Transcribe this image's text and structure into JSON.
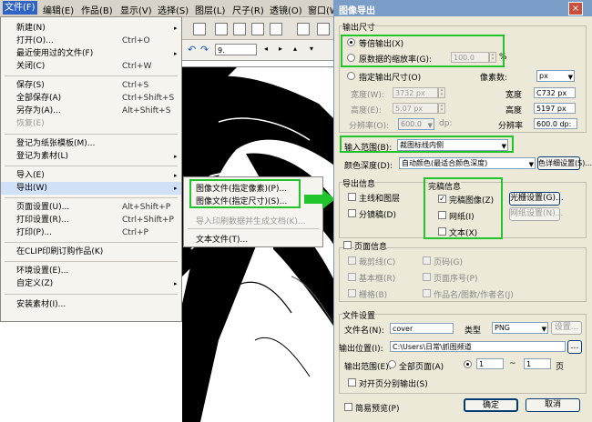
{
  "menubar": {
    "items": [
      "文件(F)",
      "编辑(E)",
      "作品(B)",
      "显示(V)",
      "选择(S)",
      "图层(L)",
      "尺子(R)",
      "透镜(O)",
      "窗口(W)"
    ]
  },
  "toolbar": {
    "zoom_value": "9."
  },
  "file_menu": {
    "items": [
      {
        "label": "新建(N)",
        "shortcut": "",
        "arrow": "▸"
      },
      {
        "label": "打开(O)...",
        "shortcut": "Ctrl+O",
        "arrow": ""
      },
      {
        "label": "最近使用过的文件(F)",
        "shortcut": "",
        "arrow": "▸"
      },
      {
        "label": "关闭(C)",
        "shortcut": "Ctrl+W",
        "arrow": ""
      },
      {
        "label": "保存(S)",
        "shortcut": "Ctrl+S",
        "arrow": ""
      },
      {
        "label": "全部保存(A)",
        "shortcut": "Ctrl+Shift+S",
        "arrow": ""
      },
      {
        "label": "另存为(A)...",
        "shortcut": "Alt+Shift+S",
        "arrow": ""
      },
      {
        "label": "恢复(E)",
        "shortcut": "",
        "arrow": ""
      },
      {
        "label": "登记为纸张模板(M)...",
        "shortcut": "",
        "arrow": ""
      },
      {
        "label": "登记为素材(L)",
        "shortcut": "",
        "arrow": "▸"
      },
      {
        "label": "导入(E)",
        "shortcut": "",
        "arrow": "▸"
      },
      {
        "label": "导出(W)",
        "shortcut": "",
        "arrow": "▸"
      },
      {
        "label": "页面设置(U)...",
        "shortcut": "Alt+Shift+P",
        "arrow": ""
      },
      {
        "label": "打印设置(R)...",
        "shortcut": "Ctrl+Shift+P",
        "arrow": ""
      },
      {
        "label": "打印(P)...",
        "shortcut": "Ctrl+P",
        "arrow": ""
      },
      {
        "label": "在CLIP印刷订购作品(K)",
        "shortcut": "",
        "arrow": ""
      },
      {
        "label": "环境设置(E)...",
        "shortcut": "",
        "arrow": ""
      },
      {
        "label": "自定义(Z)",
        "shortcut": "",
        "arrow": "▸"
      },
      {
        "label": "安装素材(I)...",
        "shortcut": "",
        "arrow": ""
      }
    ]
  },
  "export_submenu": {
    "items": [
      "图像文件(指定像素)(P)...",
      "图像文件(指定尺寸)(S)...",
      "导入印刷数据并生成文档(K)...",
      "文本文件(T)..."
    ]
  },
  "dialog": {
    "title": "图像导出",
    "output_size": {
      "group_label": "输出尺寸",
      "equal": "等倍输出(X)",
      "scale_label": "原数据的缩放率(G):",
      "scale_value": "100.0",
      "scale_unit": "%",
      "specify": "指定输出尺寸(O)",
      "pixel_count": "像素数:",
      "unit_px": "px",
      "width_label": "宽度(W):",
      "width_value": "3732 px",
      "height_label": "高度(E):",
      "height_value": "5.07 px",
      "res_label": "分辨率(O):",
      "res_value": "600.0",
      "res_unit": "dp:",
      "right_w_label": "宽度",
      "right_w_value": "C732 px",
      "right_h_label": "高度",
      "right_h_value": "5197 px",
      "right_r_label": "分辨率",
      "right_r_value": "600.0 dp:"
    },
    "output_range": {
      "label": "输入范围(B):",
      "value": "裁图标线内侧"
    },
    "color_depth": {
      "label": "颜色深度(D):",
      "value": "自动颜色(最适合颜色深度)",
      "detail_button": "色详细设置(S)..."
    },
    "output_info": {
      "label": "导出信息",
      "main_line": "主线和图层",
      "tone": "分镜稿(D)",
      "finish_label": "完稿信息",
      "finish_image": "完稿图像(Z)",
      "grid": "网纸(I)",
      "text": "文本(X)",
      "grid_settings": "光栅设置(G)...",
      "mesh_settings": "网纸设置(N)..."
    },
    "page_info": {
      "label": "页面信息",
      "items": [
        "裁剪线(C)",
        "页码(G)",
        "基本框(R)",
        "页面序号(P)",
        "栅格(B)",
        "作品名/图数/作者名(J)"
      ]
    },
    "file_settings": {
      "label": "文件设置",
      "filename_label": "文件名(N):",
      "filename_value": "cover",
      "type_label": "类型",
      "type_value": "PNG",
      "settings_button": "设置...",
      "location_label": "输出位置(I):",
      "location_value": "C:\\Users\\日常\\抓图频道",
      "range_label": "输出范围(E):",
      "all_pages": "全部页面(A)",
      "from_page": "1",
      "to_sep": "~",
      "to_page": "1",
      "page_suffix": "页",
      "spread": "对开页分别输出(S)"
    },
    "preview": "简易预览(P)",
    "ok": "确定",
    "cancel": "取消"
  },
  "colors": {
    "highlight": "#2f63c6",
    "annotation_green": "#22c42c",
    "title_bar": "#7b9ec8"
  }
}
